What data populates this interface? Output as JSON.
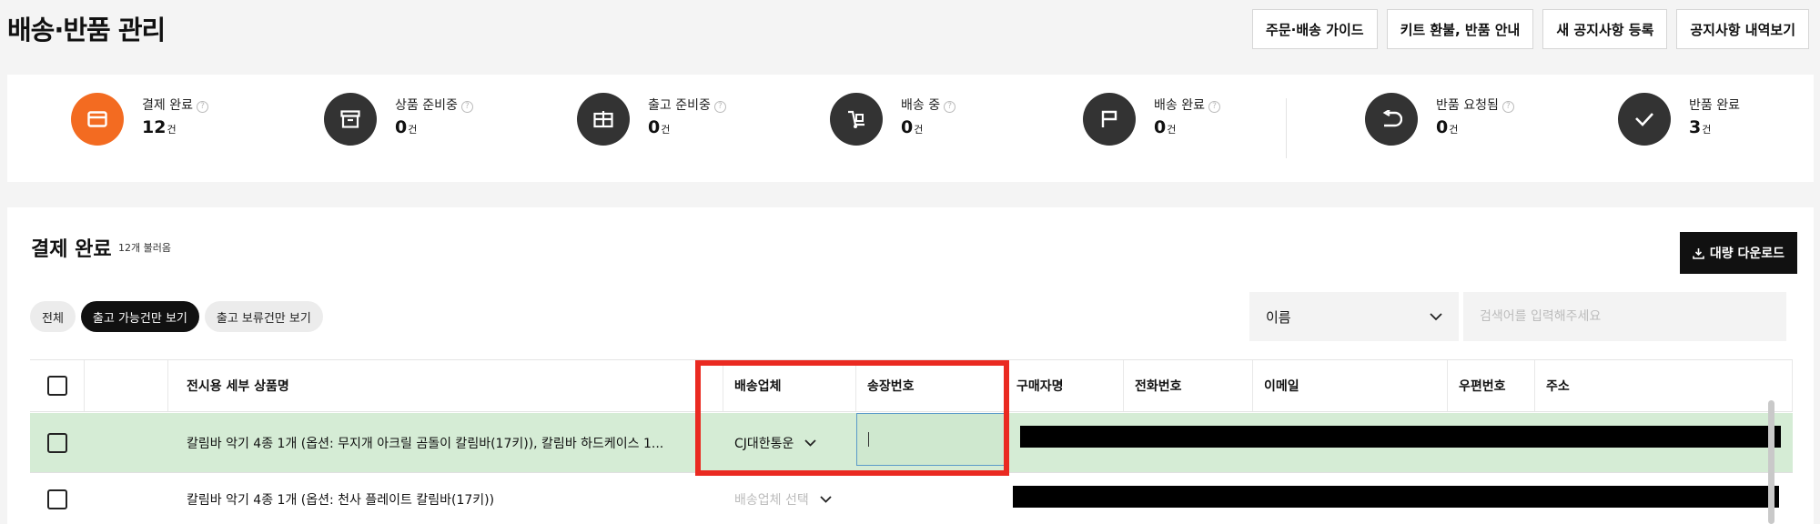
{
  "page": {
    "title": "배송·반품 관리",
    "actions": [
      "주문·배송 가이드",
      "키트 환불, 반품 안내",
      "새 공지사항 등록",
      "공지사항 내역보기"
    ]
  },
  "statuses": [
    {
      "label": "결제 완료",
      "count": "12",
      "unit": "건",
      "icon": "card-icon",
      "active": true,
      "has_help": true
    },
    {
      "label": "상품 준비중",
      "count": "0",
      "unit": "건",
      "icon": "box-icon",
      "active": false,
      "has_help": true
    },
    {
      "label": "출고 준비중",
      "count": "0",
      "unit": "건",
      "icon": "package-icon",
      "active": false,
      "has_help": true
    },
    {
      "label": "배송 중",
      "count": "0",
      "unit": "건",
      "icon": "dolly-icon",
      "active": false,
      "has_help": true
    },
    {
      "label": "배송 완료",
      "count": "0",
      "unit": "건",
      "icon": "flag-icon",
      "active": false,
      "has_help": true
    },
    {
      "label": "반품 요청됨",
      "count": "0",
      "unit": "건",
      "icon": "return-icon",
      "active": false,
      "has_help": true
    },
    {
      "label": "반품 완료",
      "count": "3",
      "unit": "건",
      "icon": "check-icon",
      "active": false,
      "has_help": false
    }
  ],
  "section": {
    "title": "결제 완료",
    "subtitle": "12개 불러옴",
    "download_label": "대량 다운로드"
  },
  "filters": {
    "chips": [
      "전체",
      "출고 가능건만 보기",
      "출고 보류건만 보기"
    ],
    "active_chip": 1
  },
  "search": {
    "field": "이름",
    "placeholder": "검색어를 입력해주세요"
  },
  "table": {
    "columns": [
      "전시용 세부 상품명",
      "배송업체",
      "송장번호",
      "구매자명",
      "전화번호",
      "이메일",
      "우편번호",
      "주소"
    ],
    "rows": [
      {
        "product": "칼림바 악기 4종 1개 (옵션: 무지개 아크릴 곰돌이 칼림바(17키)), 칼림바 하드케이스 1...",
        "carrier": "CJ대한통운",
        "tracking": ""
      },
      {
        "product": "칼림바 악기 4종 1개 (옵션: 천사 플레이트 칼림바(17키))",
        "carrier": "배송업체 선택",
        "tracking": ""
      }
    ]
  },
  "colors": {
    "accent": "#f36b21",
    "selected_row": "#d5ecd5",
    "highlight_box": "#ea2a21"
  }
}
